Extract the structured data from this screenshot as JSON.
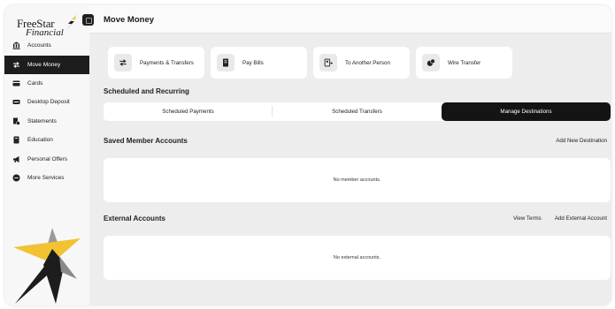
{
  "brand": {
    "name_line1": "FreeStar",
    "name_line2": "Financial",
    "accent": "#f2c232",
    "dark": "#1d1d1d"
  },
  "sidebar": {
    "items": [
      {
        "label": "Accounts",
        "icon": "bank-icon",
        "active": false
      },
      {
        "label": "Move Money",
        "icon": "transfer-icon",
        "active": true
      },
      {
        "label": "Cards",
        "icon": "card-icon",
        "active": false
      },
      {
        "label": "Desktop Deposit",
        "icon": "deposit-icon",
        "active": false
      },
      {
        "label": "Statements",
        "icon": "statements-icon",
        "active": false
      },
      {
        "label": "Education",
        "icon": "book-icon",
        "active": false
      },
      {
        "label": "Personal Offers",
        "icon": "megaphone-icon",
        "active": false
      },
      {
        "label": "More Services",
        "icon": "more-icon",
        "active": false
      }
    ]
  },
  "header": {
    "title": "Move Money"
  },
  "quick_actions": [
    {
      "label": "Payments & Transfers",
      "icon": "transfer-icon"
    },
    {
      "label": "Pay Bills",
      "icon": "bill-icon"
    },
    {
      "label": "To Another Person",
      "icon": "person-transfer-icon"
    },
    {
      "label": "Wire Transfer",
      "icon": "wire-icon"
    }
  ],
  "scheduled": {
    "title": "Scheduled and Recurring",
    "tabs": [
      {
        "label": "Scheduled Payments",
        "active": false
      },
      {
        "label": "Scheduled Transfers",
        "active": false
      },
      {
        "label": "Manage Destinations",
        "active": true
      }
    ]
  },
  "saved_members": {
    "title": "Saved Member Accounts",
    "add_link": "Add New Destination",
    "empty_text": "No member accounts."
  },
  "external": {
    "title": "External Accounts",
    "view_terms": "View Terms",
    "add_link": "Add External Account",
    "empty_text": "No external accounts."
  }
}
